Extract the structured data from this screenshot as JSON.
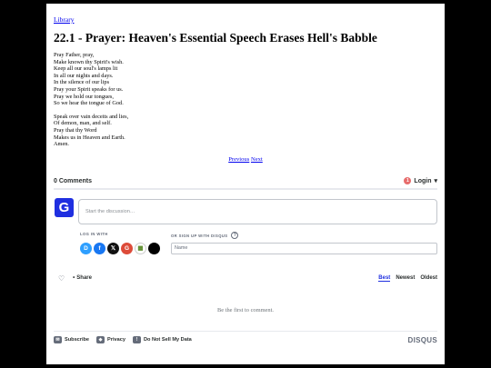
{
  "breadcrumb": {
    "label": "Library"
  },
  "title": "22.1 - Prayer: Heaven's Essential Speech Erases Hell's Babble",
  "poem": {
    "stanza1": [
      "Pray Father, pray,",
      "Make known thy Spirit's wish.",
      "Keep all our soul's lamps lit",
      "In all our nights and days.",
      "In the silence of our lips",
      "Pray your Spirit speaks for us.",
      "Pray we hold our tongues,",
      "So we hear the tongue of God."
    ],
    "stanza2": [
      "Speak over vain deceits and lies,",
      "Of demon, man, and self.",
      "Pray that thy Word",
      "Makes us in Heaven and Earth.",
      "Amen."
    ]
  },
  "pager": {
    "previous": "Previous",
    "next": "Next"
  },
  "comments": {
    "count_label": "0 Comments",
    "login_label": "Login",
    "login_badge": "1",
    "avatar_letter": "G",
    "editor_placeholder": "Start the discussion…",
    "log_in_with": "LOG IN WITH",
    "or_sign_up": "OR SIGN UP WITH DISQUS",
    "help_mark": "?",
    "name_placeholder": "Name",
    "share_label": "Share",
    "sort": {
      "best": "Best",
      "newest": "Newest",
      "oldest": "Oldest"
    },
    "empty_text": "Be the first to comment.",
    "footer": {
      "subscribe": "Subscribe",
      "privacy": "Privacy",
      "do_not_sell": "Do Not Sell My Data",
      "brand": "DISQUS"
    }
  },
  "social": [
    {
      "icon": "disqus-icon",
      "glyph": "D",
      "color": "#2e9fff"
    },
    {
      "icon": "facebook-icon",
      "glyph": "f",
      "color": "#1877f2"
    },
    {
      "icon": "x-icon",
      "glyph": "𝕏",
      "color": "#111111"
    },
    {
      "icon": "google-icon",
      "glyph": "G",
      "color": "#dd4b39"
    },
    {
      "icon": "microsoft-icon",
      "glyph": "▦",
      "color": "#ffffff"
    },
    {
      "icon": "apple-icon",
      "glyph": "",
      "color": "#000000"
    }
  ],
  "colors": {
    "accent": "#1f2fe0",
    "link": "#0000ee"
  }
}
